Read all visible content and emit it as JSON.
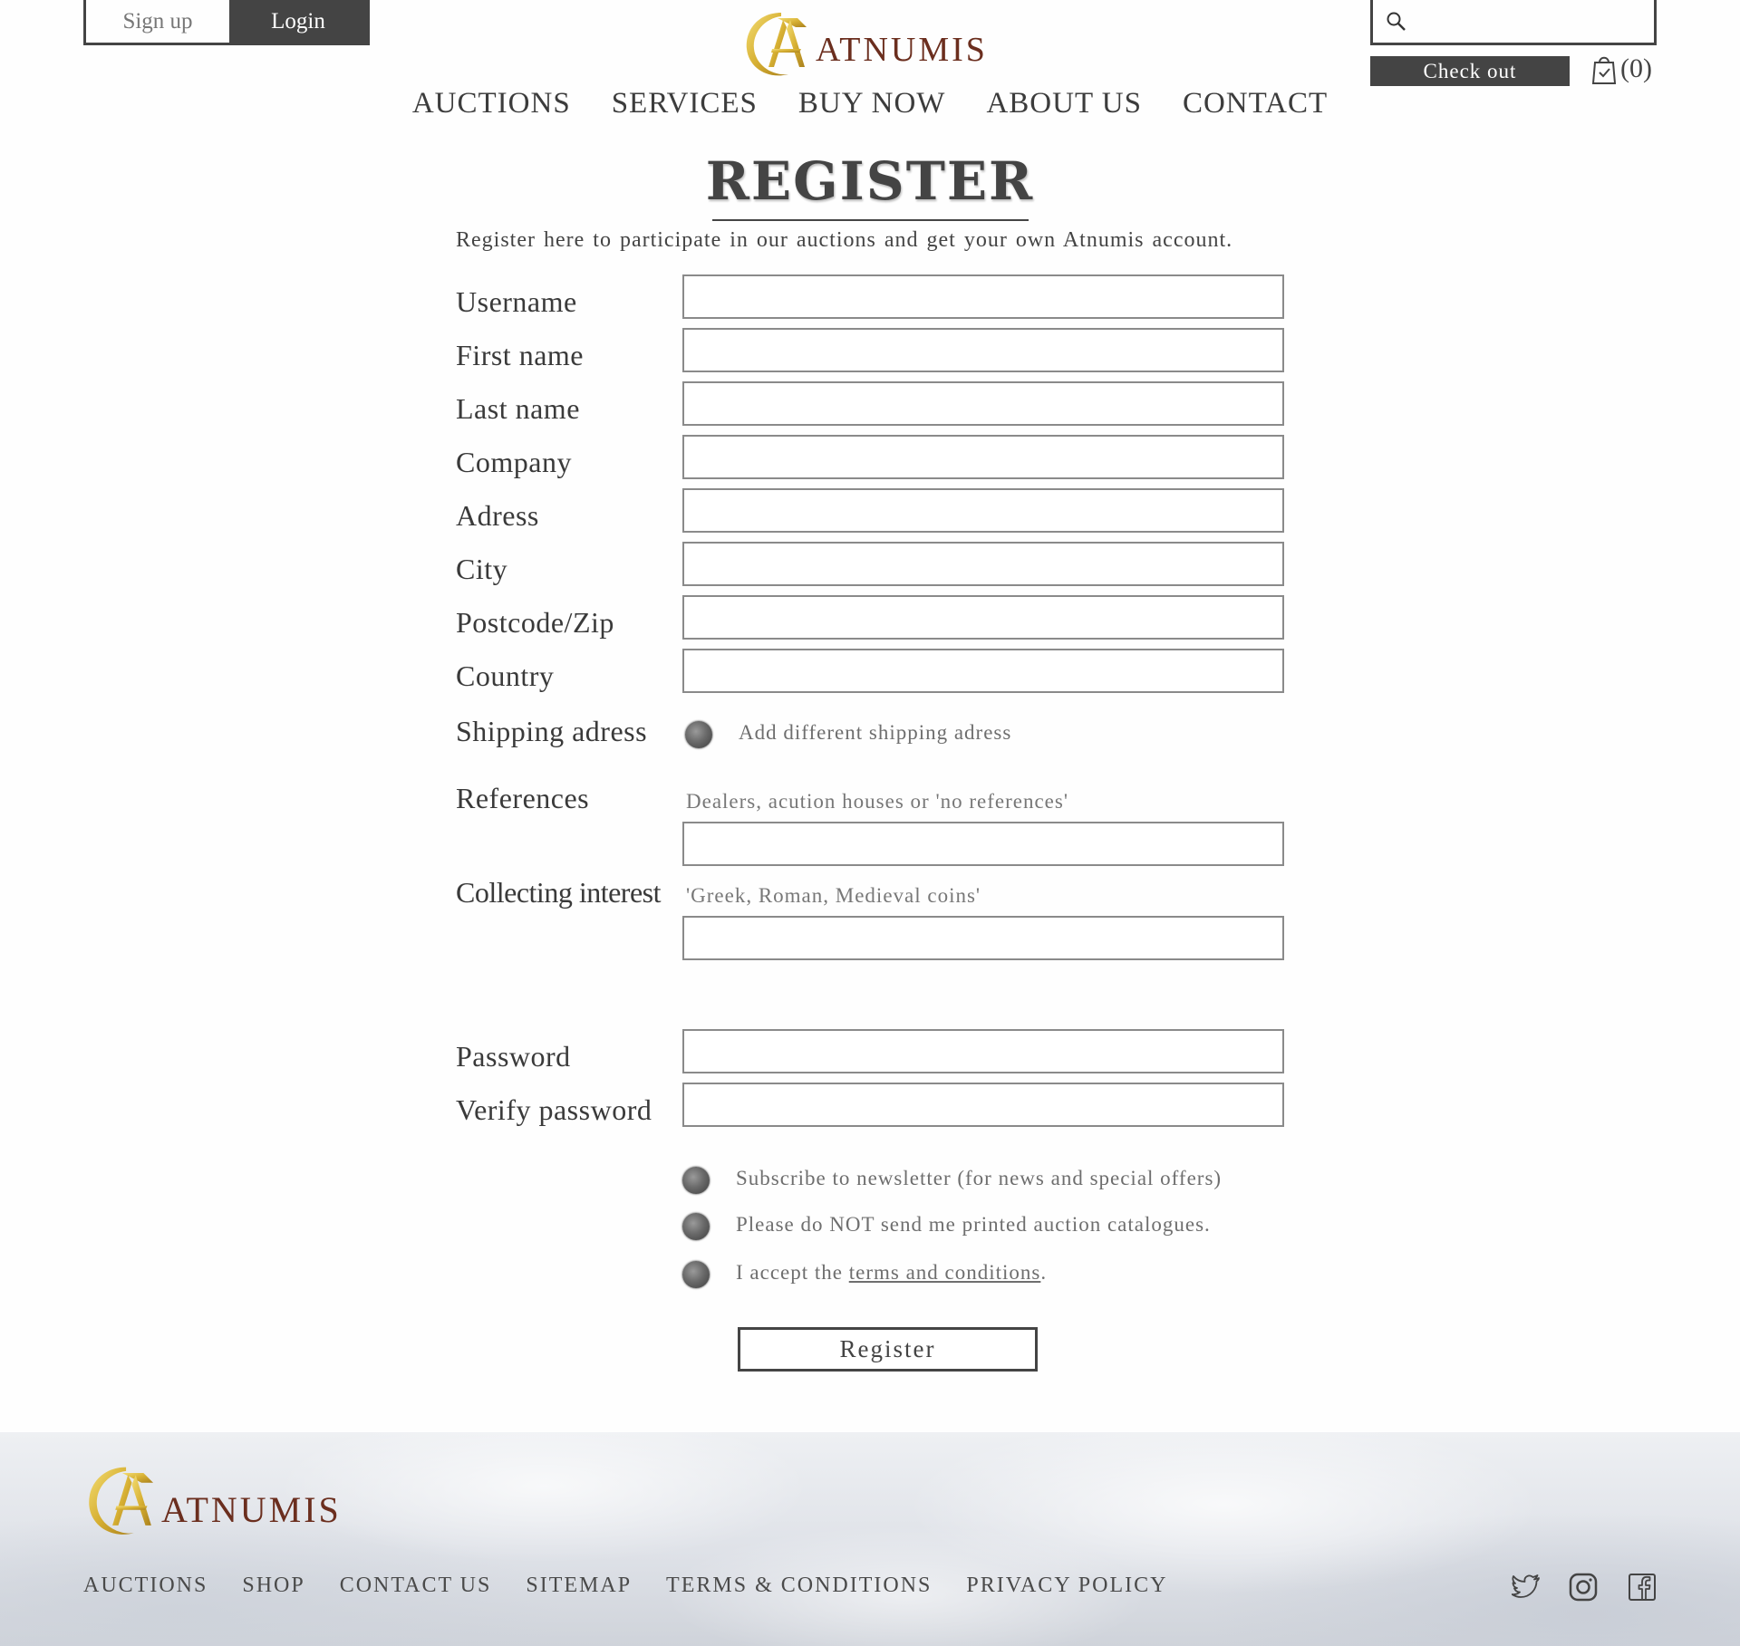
{
  "header": {
    "signup_label": "Sign up",
    "login_label": "Login",
    "brand": "ATNUMIS",
    "search_placeholder": "",
    "checkout_label": "Check out",
    "cart_count": "(0)"
  },
  "nav": [
    "AUCTIONS",
    "SERVICES",
    "BUY NOW",
    "ABOUT US",
    "CONTACT"
  ],
  "page": {
    "title": "REGISTER",
    "intro": "Register here to participate in our auctions and get your own Atnumis account."
  },
  "form": {
    "fields": [
      {
        "label": "Username",
        "value": ""
      },
      {
        "label": "First name",
        "value": ""
      },
      {
        "label": "Last name",
        "value": ""
      },
      {
        "label": "Company",
        "value": ""
      },
      {
        "label": "Adress",
        "value": ""
      },
      {
        "label": "City",
        "value": ""
      },
      {
        "label": "Postcode/Zip",
        "value": ""
      },
      {
        "label": "Country",
        "value": ""
      }
    ],
    "shipping_label": "Shipping adress",
    "shipping_option": "Add different shipping adress",
    "references_label": "References",
    "references_hint": "Dealers, acution houses or 'no references'",
    "interest_label": "Collecting interest",
    "interest_hint": "'Greek, Roman, Medieval coins'",
    "password_label": "Password",
    "verify_label": "Verify password",
    "newsletter_option": "Subscribe to newsletter (for news and special offers)",
    "catalogue_option": "Please do NOT send me printed auction catalogues.",
    "terms_prefix": "I accept the ",
    "terms_link": "terms and conditions",
    "terms_suffix": ".",
    "submit_label": "Register"
  },
  "footer": {
    "brand": "ATNUMIS",
    "links": [
      "AUCTIONS",
      "SHOP",
      "CONTACT US",
      "SITEMAP",
      "TERMS & CONDITIONS",
      "PRIVACY POLICY"
    ],
    "social": [
      "twitter-icon",
      "instagram-icon",
      "facebook-icon"
    ]
  },
  "colors": {
    "accent_dark": "#444444",
    "brand_gold": "#d9b43a",
    "brand_text": "#6b2e1e"
  }
}
